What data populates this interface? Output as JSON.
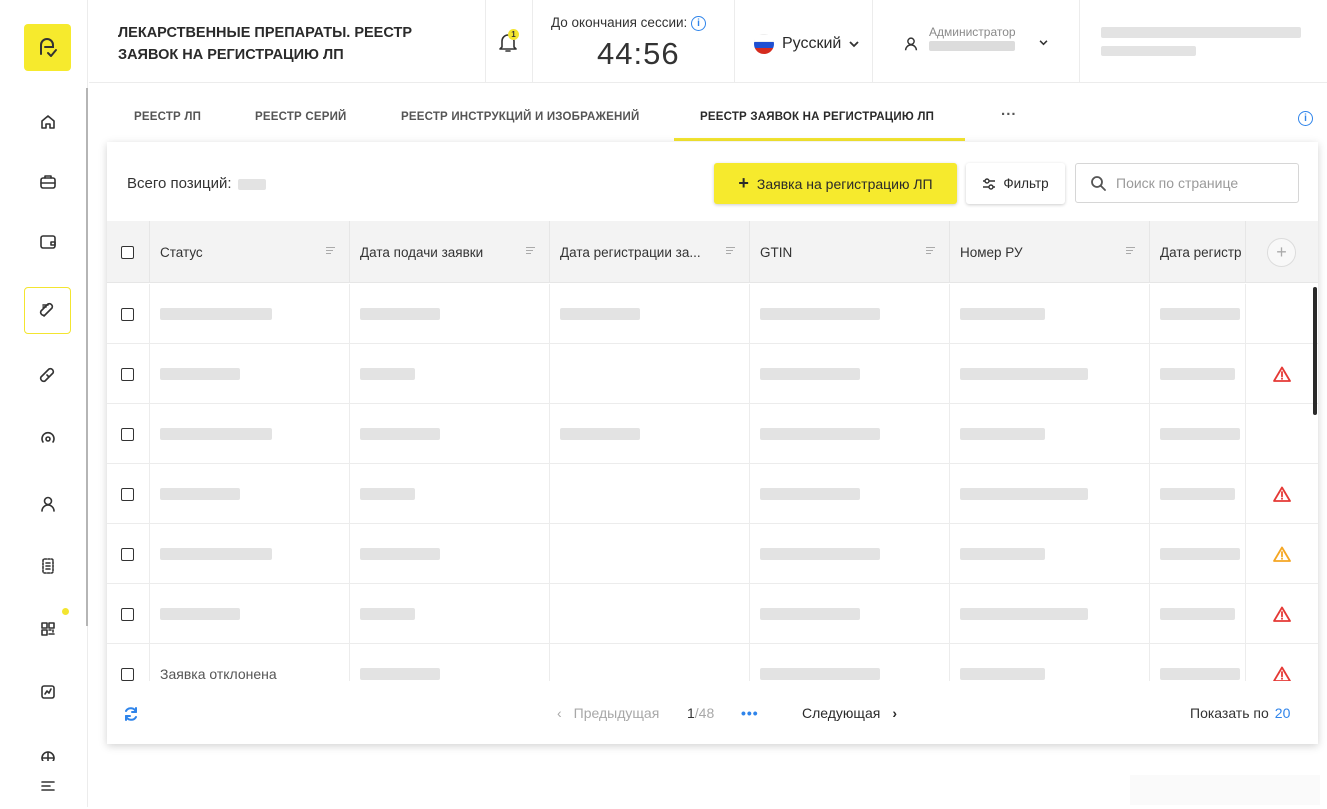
{
  "header": {
    "title": "ЛЕКАРСТВЕННЫЕ ПРЕПАРАТЫ. РЕЕСТР ЗАЯВОК НА РЕГИСТРАЦИЮ ЛП",
    "notification_count": "1",
    "session_label": "До окончания сессии:",
    "session_time": "44:56",
    "language": "Русский",
    "user_role": "Администратор"
  },
  "tabs": [
    {
      "label": "РЕЕСТР ЛП",
      "active": false
    },
    {
      "label": "РЕЕСТР СЕРИЙ",
      "active": false
    },
    {
      "label": "РЕЕСТР ИНСТРУКЦИЙ И ИЗОБРАЖЕНИЙ",
      "active": false
    },
    {
      "label": "РЕЕСТР ЗАЯВОК НА РЕГИСТРАЦИЮ ЛП",
      "active": true
    },
    {
      "label": "···",
      "active": false
    }
  ],
  "toolbar": {
    "total_label": "Всего позиций:",
    "add_label": "Заявка на регистрацию ЛП",
    "filter_label": "Фильтр",
    "search_placeholder": "Поиск по странице"
  },
  "table": {
    "columns": [
      "Статус",
      "Дата подачи заявки",
      "Дата регистрации за...",
      "GTIN",
      "Номер РУ",
      "Дата регистр"
    ],
    "rows": [
      {
        "status": "",
        "warning": ""
      },
      {
        "status": "",
        "warning": "red"
      },
      {
        "status": "",
        "warning": ""
      },
      {
        "status": "",
        "warning": "red"
      },
      {
        "status": "",
        "warning": "orange"
      },
      {
        "status": "",
        "warning": "red"
      },
      {
        "status": "Заявка отклонена",
        "warning": "red"
      }
    ]
  },
  "pagination": {
    "prev_label": "Предыдущая",
    "current_page": "1",
    "total_pages": "/48",
    "more": "•••",
    "next_label": "Следующая",
    "page_size_label": "Показать по",
    "page_size": "20"
  },
  "colors": {
    "accent": "#f6ea2d",
    "link": "#2f84ea",
    "warning_red": "#e53935",
    "warning_orange": "#f5a623"
  }
}
